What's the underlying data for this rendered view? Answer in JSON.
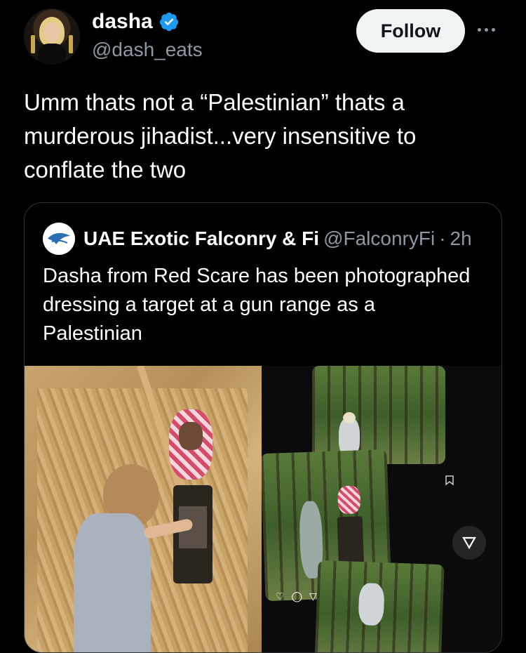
{
  "author": {
    "name": "dasha",
    "handle": "@dash_eats",
    "verified": true,
    "verified_color": "#1d9bf0"
  },
  "follow_label": "Follow",
  "more_icon": "more-horizontal-icon",
  "tweet_text": "Umm thats not a “Palestinian” thats a murderous jihadist...very insensitive to conflate the two",
  "quoted": {
    "name": "UAE Exotic Falconry & Fi",
    "handle": "@FalconryFi",
    "separator": "·",
    "time": "2h",
    "text": "Dasha from Red Scare has been photographed dressing a target at a gun range as a Palestinian"
  },
  "media": {
    "mini_actions": "♡ ◯ ▽"
  }
}
